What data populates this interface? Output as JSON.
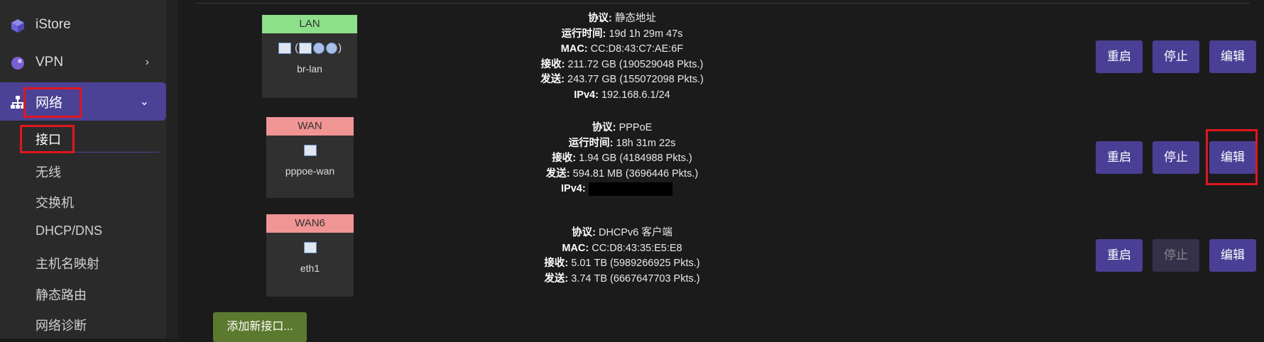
{
  "sidebar": {
    "items": [
      {
        "label": "iStore",
        "icon": "cube-icon"
      },
      {
        "label": "VPN",
        "icon": "shield-icon",
        "chevron": "›"
      },
      {
        "label": "网络",
        "icon": "network-icon",
        "chevron": "⌄",
        "active": true
      }
    ],
    "subitems": [
      "接口",
      "无线",
      "交换机",
      "DHCP/DNS",
      "主机名映射",
      "静态路由",
      "网络诊断"
    ]
  },
  "labels": {
    "protocol": "协议:",
    "uptime": "运行时间:",
    "mac": "MAC:",
    "rx": "接收:",
    "tx": "发送:",
    "ipv4": "IPv4:"
  },
  "interfaces": [
    {
      "name": "LAN",
      "device": "br-lan",
      "protocol": "静态地址",
      "uptime": "19d 1h 29m 47s",
      "mac": "CC:D8:43:C7:AE:6F",
      "rx": "211.72 GB (190529048 Pkts.)",
      "tx": "243.77 GB (155072098 Pkts.)",
      "ipv4": "192.168.6.1/24",
      "header_color": "#8ce08a"
    },
    {
      "name": "WAN",
      "device": "pppoe-wan",
      "protocol": "PPPoE",
      "uptime": "18h 31m 22s",
      "rx": "1.94 GB (4184988 Pkts.)",
      "tx": "594.81 MB (3696446 Pkts.)",
      "ipv4": "",
      "header_color": "#f19494"
    },
    {
      "name": "WAN6",
      "device": "eth1",
      "protocol": "DHCPv6 客户端",
      "mac": "CC:D8:43:35:E5:E8",
      "rx": "5.01 TB (5989266925 Pkts.)",
      "tx": "3.74 TB (6667647703 Pkts.)",
      "header_color": "#f19494"
    }
  ],
  "buttons": {
    "restart": "重启",
    "stop": "停止",
    "edit": "编辑",
    "add": "添加新接口..."
  },
  "colors": {
    "accent": "#4a3f95",
    "highlight": "#e0161f",
    "add_button": "#5c7a2f"
  }
}
